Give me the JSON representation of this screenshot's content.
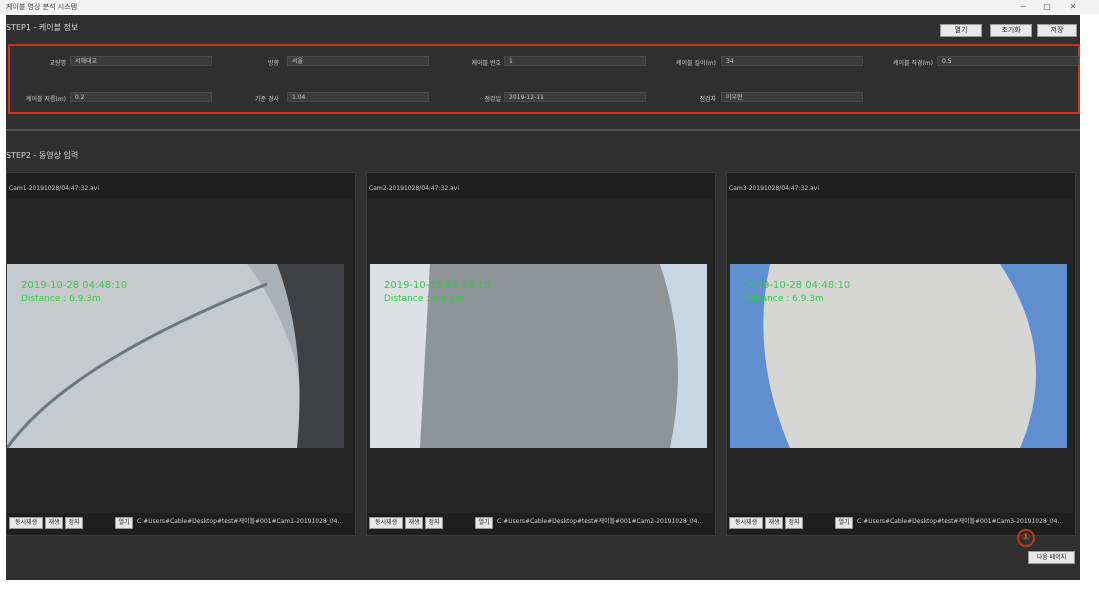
{
  "window": {
    "title": "케이블 영상 분석 시스템",
    "minimize": "─",
    "maximize": "□",
    "close": "✕"
  },
  "step1": {
    "title": "STEP1 - 케이블 정보",
    "buttons": [
      "열기",
      "초기화",
      "저장"
    ],
    "fields": [
      {
        "label": "교량명",
        "value": "서해대교"
      },
      {
        "label": "방향",
        "value": "서울"
      },
      {
        "label": "케이블 번호",
        "value": "1"
      },
      {
        "label": "케이블 길이(m)",
        "value": "34"
      },
      {
        "label": "케이블 직경(m)",
        "value": "0.5"
      },
      {
        "label": "케이블 지름(m)",
        "value": "0.2"
      },
      {
        "label": "기준 경사",
        "value": "1.04"
      },
      {
        "label": "점검일",
        "value": "2019-12-11"
      },
      {
        "label": "점검자",
        "value": "이우현"
      }
    ]
  },
  "step2": {
    "title": "STEP2 - 동영상 입력",
    "cameras": [
      {
        "file": "Cam1-20191028/04:47:32.avi",
        "overlay_date": "2019-10-28 04:48:10",
        "overlay_distance": "Distance : 6.9.3m",
        "buttons": [
          "동시재생",
          "재생",
          "정지"
        ],
        "open_button": "열기",
        "path": "C:#Users#Cable#Desktop#test#케이블#001#Cam1-20191028_04..."
      },
      {
        "file": "Cam2-20191028/04:47:32.avi",
        "overlay_date": "2019-10-28 04:48:10",
        "overlay_distance": "Distance : 6.9.3m",
        "buttons": [
          "동시재생",
          "재생",
          "정지"
        ],
        "open_button": "열기",
        "path": "C:#Users#Cable#Desktop#test#케이블#001#Cam2-20191028_04..."
      },
      {
        "file": "Cam3-20191028/04:47:32.avi",
        "overlay_date": "2019-10-28 04:48:10",
        "overlay_distance": "Distance : 6.9.3m",
        "buttons": [
          "동시재생",
          "재생",
          "정지"
        ],
        "open_button": "열기",
        "path": "C:#Users#Cable#Desktop#test#케이블#001#Cam3-20191028_04..."
      }
    ]
  },
  "footer": {
    "next_button": "다음 페이지",
    "marker": "①"
  },
  "colors": {
    "highlight": "#c0391a",
    "overlay_text": "#2ecc40",
    "background": "#2f2f2f"
  }
}
